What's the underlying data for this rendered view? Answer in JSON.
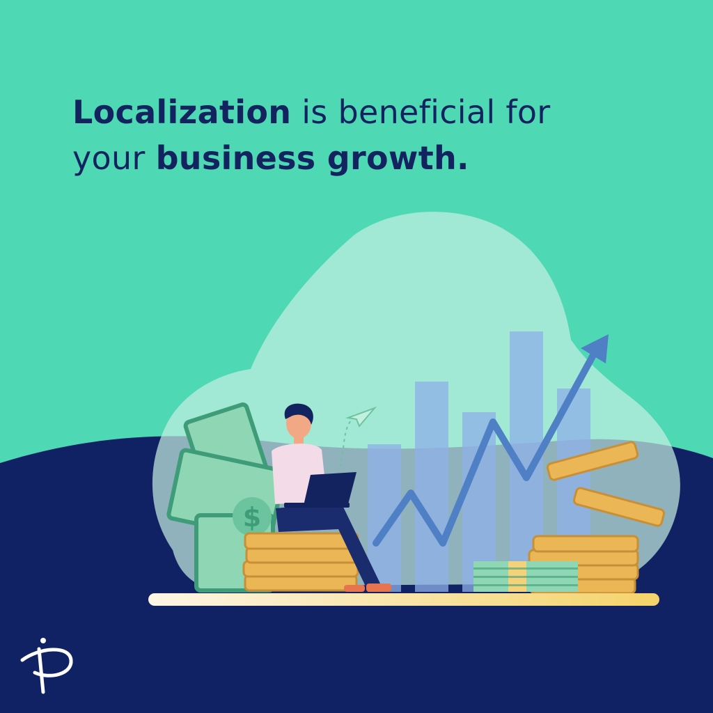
{
  "headline": {
    "line1_bold": "Localization",
    "line1_rest": " is beneficial for",
    "line2_start": "your ",
    "line2_bold": "business growth."
  },
  "colors": {
    "background_top": "#4fd8b4",
    "background_bottom": "#112264",
    "headline_text": "#12235f",
    "cloud": "#c4f0e2",
    "coin": "#eab656",
    "cash": "#8fd6b4",
    "arrow": "#4f80c6",
    "bar": "#8fb0e8"
  },
  "icons": [
    "brand-logo-icon",
    "growth-arrow-icon",
    "paper-plane-icon",
    "laptop-icon",
    "dollar-sign-icon"
  ]
}
